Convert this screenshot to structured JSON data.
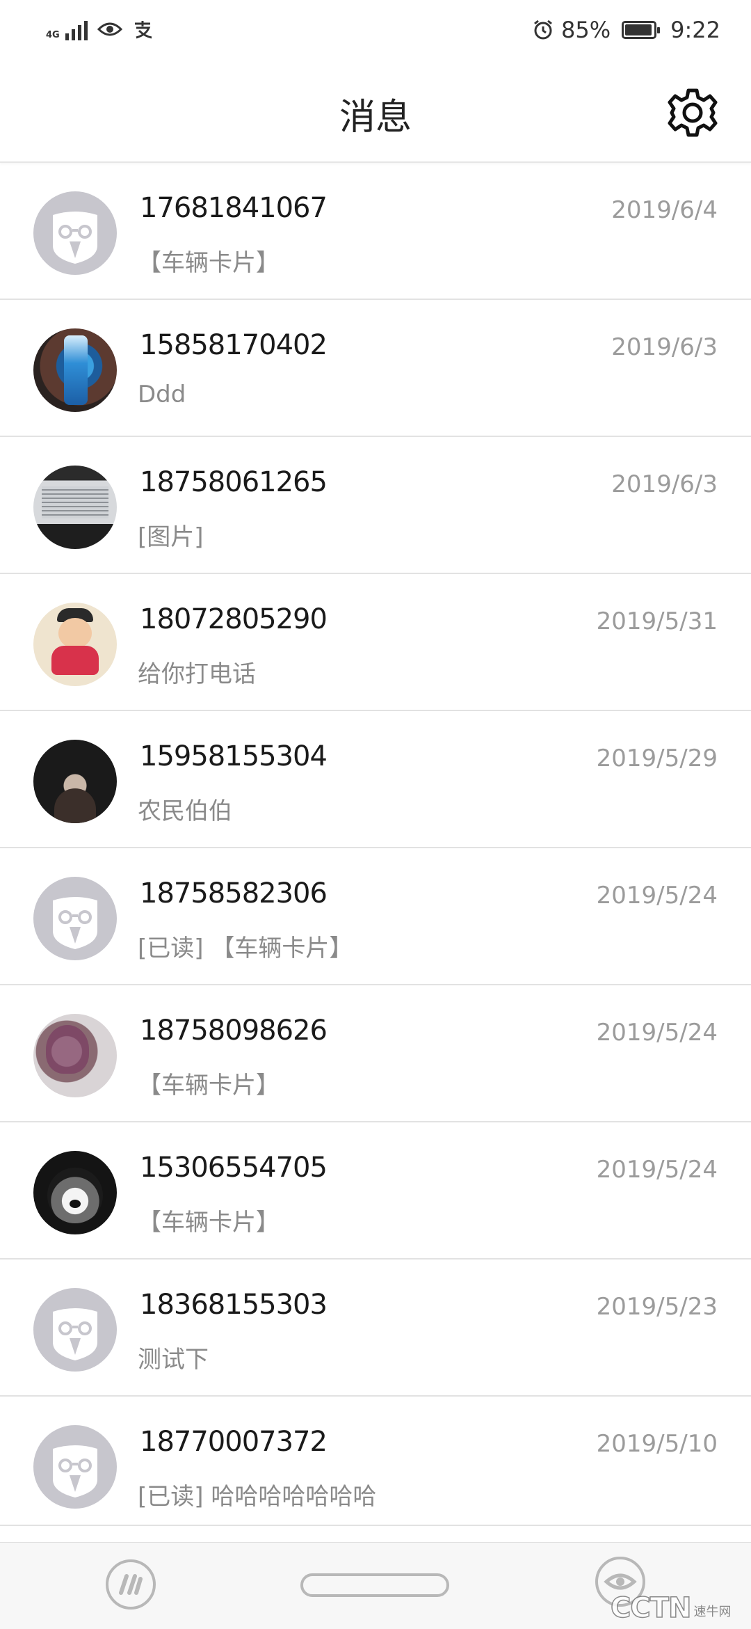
{
  "status_bar": {
    "network": "4G",
    "battery_percent": "85%",
    "battery_level": 0.85,
    "time": "9:22",
    "icons": [
      "signal-icon",
      "eye-icon",
      "alipay-icon",
      "alarm-icon",
      "battery-icon"
    ]
  },
  "header": {
    "title": "消息",
    "settings_icon": "gear-icon"
  },
  "messages": [
    {
      "phone": "17681841067",
      "preview": "【车辆卡片】",
      "date": "2019/6/4",
      "avatar": "default-avatar"
    },
    {
      "phone": "15858170402",
      "preview": "Ddd",
      "date": "2019/6/3",
      "avatar": "photo-drink-bottle"
    },
    {
      "phone": "18758061265",
      "preview": "[图片]",
      "date": "2019/6/3",
      "avatar": "photo-monitor-screen"
    },
    {
      "phone": "18072805290",
      "preview": "给你打电话",
      "date": "2019/5/31",
      "avatar": "photo-cartoon-figure"
    },
    {
      "phone": "15958155304",
      "preview": "农民伯伯",
      "date": "2019/5/29",
      "avatar": "photo-dark-hair-person"
    },
    {
      "phone": "18758582306",
      "preview": "[已读] 【车辆卡片】",
      "date": "2019/5/24",
      "avatar": "default-avatar"
    },
    {
      "phone": "18758098626",
      "preview": "【车辆卡片】",
      "date": "2019/5/24",
      "avatar": "photo-woman-portrait"
    },
    {
      "phone": "15306554705",
      "preview": "【车辆卡片】",
      "date": "2019/5/24",
      "avatar": "photo-husky-dog"
    },
    {
      "phone": "18368155303",
      "preview": "测试下",
      "date": "2019/5/23",
      "avatar": "default-avatar"
    },
    {
      "phone": "18770007372",
      "preview": "[已读] 哈哈哈哈哈哈哈",
      "date": "2019/5/10",
      "avatar": "default-avatar"
    }
  ],
  "bottom_nav": {
    "left_icon": "app-logo-icon",
    "center_icon": "home-pill-icon",
    "right_icon": "message-eye-icon"
  },
  "watermark": {
    "text": "CCTN",
    "small": "速牛网"
  },
  "colors": {
    "default_avatar_bg": "#c7c6cd",
    "divider": "#e2e2e2",
    "preview_text": "#8a8a8a",
    "date_text": "#9b9b9b"
  }
}
